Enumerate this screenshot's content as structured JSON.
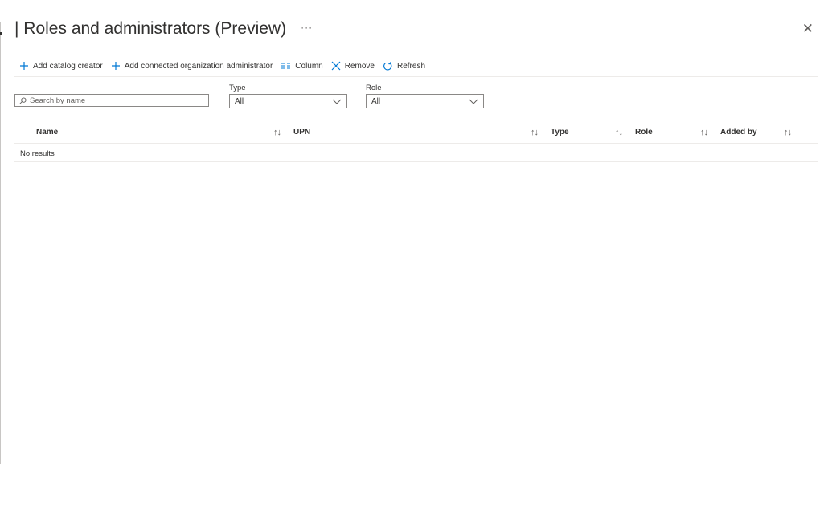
{
  "header": {
    "title": "| Roles and administrators (Preview)",
    "more": "···",
    "close": "✕"
  },
  "toolbar": {
    "add_catalog_creator": "Add catalog creator",
    "add_connected_org_admin": "Add connected organization administrator",
    "column": "Column",
    "remove": "Remove",
    "refresh": "Refresh"
  },
  "filters": {
    "search_placeholder": "Search by name",
    "type_label": "Type",
    "type_value": "All",
    "role_label": "Role",
    "role_value": "All"
  },
  "table": {
    "columns": [
      "Name",
      "UPN",
      "Type",
      "Role",
      "Added by"
    ],
    "sort_glyph": "↑↓",
    "empty_text": "No results"
  },
  "colors": {
    "accent": "#0078d4",
    "text": "#323130",
    "border": "#8a8886"
  },
  "icons": [
    "plus-icon",
    "columns-icon",
    "remove-x-icon",
    "refresh-icon",
    "search-icon",
    "chevron-down-icon",
    "close-icon",
    "more-icon",
    "sort-icon"
  ]
}
